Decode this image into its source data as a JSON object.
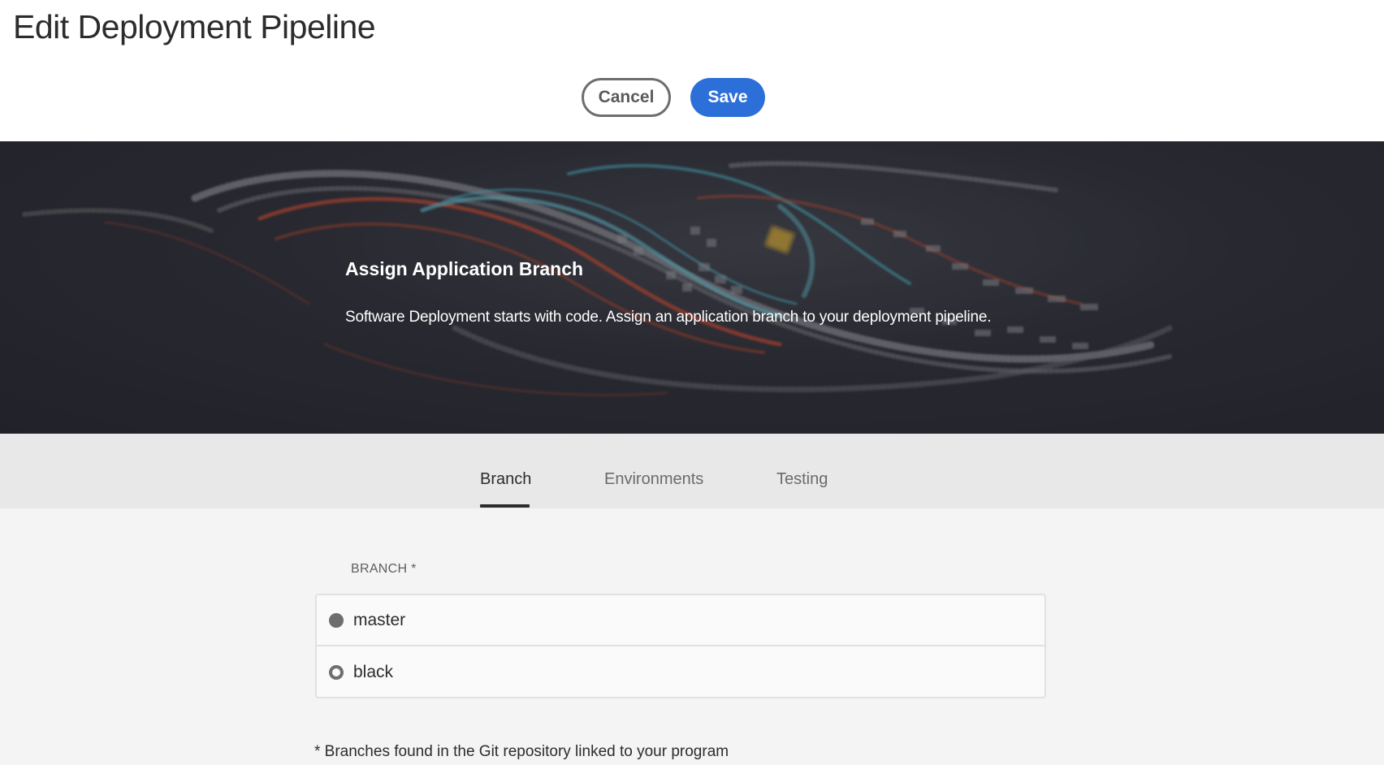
{
  "header": {
    "title": "Edit Deployment Pipeline",
    "cancel_label": "Cancel",
    "save_label": "Save",
    "save_color": "#2d6fd8"
  },
  "hero": {
    "title": "Assign Application Branch",
    "subtitle": "Software Deployment starts with code. Assign an application branch to your deployment pipeline.",
    "background": "abstract-code-ribbons-image"
  },
  "tabs": [
    {
      "label": "Branch",
      "active": true
    },
    {
      "label": "Environments",
      "active": false
    },
    {
      "label": "Testing",
      "active": false
    }
  ],
  "branch_form": {
    "label": "BRANCH *",
    "options": [
      {
        "label": "master",
        "selected": true
      },
      {
        "label": "black",
        "selected": false
      }
    ],
    "footnote": "* Branches found in the Git repository linked to your program"
  }
}
